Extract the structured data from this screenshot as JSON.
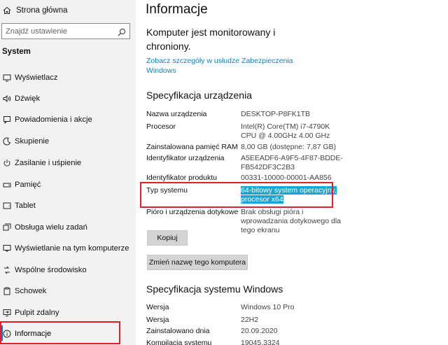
{
  "sidebar": {
    "home_label": "Strona główna",
    "search_placeholder": "Znajdź ustawienie",
    "section_title": "System",
    "items": [
      {
        "label": "Wyświetlacz",
        "icon": "display-icon"
      },
      {
        "label": "Dźwięk",
        "icon": "sound-icon"
      },
      {
        "label": "Powiadomienia i akcje",
        "icon": "notifications-icon"
      },
      {
        "label": "Skupienie",
        "icon": "focus-assist-icon"
      },
      {
        "label": "Zasilanie i uśpienie",
        "icon": "power-icon"
      },
      {
        "label": "Pamięć",
        "icon": "storage-icon"
      },
      {
        "label": "Tablet",
        "icon": "tablet-icon"
      },
      {
        "label": "Obsługa wielu zadań",
        "icon": "multitasking-icon"
      },
      {
        "label": "Wyświetlanie na tym komputerze",
        "icon": "projecting-icon"
      },
      {
        "label": "Wspólne środowisko",
        "icon": "shared-experiences-icon"
      },
      {
        "label": "Schowek",
        "icon": "clipboard-icon"
      },
      {
        "label": "Pulpit zdalny",
        "icon": "remote-desktop-icon"
      },
      {
        "label": "Informacje",
        "icon": "info-icon"
      }
    ],
    "active_item": "Informacje"
  },
  "main": {
    "title": "Informacje",
    "protection_status": "Komputer jest monitorowany i chroniony.",
    "security_link": "Zobacz szczegóły w usłudze Zabezpieczenia Windows",
    "device_spec_title": "Specyfikacja urządzenia",
    "device_specs": [
      {
        "key": "Nazwa urządzenia",
        "value": "DESKTOP-P8FK1TB"
      },
      {
        "key": "Procesor",
        "value": "Intel(R) Core(TM) i7-4790K CPU @ 4.00GHz   4.00 GHz"
      },
      {
        "key": "Zainstalowana pamięć RAM",
        "value": "8,00 GB (dostępne: 7,87 GB)"
      },
      {
        "key": "Identyfikator urządzenia",
        "value": "A5EEADF6-A9F5-4F87-BDDE-FB542DF3C2B3"
      },
      {
        "key": "Identyfikator produktu",
        "value": "00331-10000-00001-AA856"
      },
      {
        "key": "Typ systemu",
        "value": "64-bitowy system operacyjny, procesor x64"
      },
      {
        "key": "Pióro i urządzenia dotykowe",
        "value": "Brak obsługi pióra i wprowadzania dotykowego dla tego ekranu"
      }
    ],
    "copy_button": "Kopiuj",
    "rename_button": "Zmień nazwę tego komputera",
    "windows_spec_title": "Specyfikacja systemu Windows",
    "windows_specs": [
      {
        "key": "Wersja",
        "value": "Windows 10 Pro"
      },
      {
        "key": "Wersja",
        "value": "22H2"
      },
      {
        "key": "Zainstalowano dnia",
        "value": "20.09.2020"
      },
      {
        "key": "Kompilacja systemu",
        "value": "19045.3324"
      }
    ]
  },
  "colors": {
    "accent": "#0078d7",
    "link": "#0a84c6",
    "highlight": "#1aa3d6",
    "annotation_red": "#e0202a",
    "sidebar_bg": "#f2f2f2"
  }
}
